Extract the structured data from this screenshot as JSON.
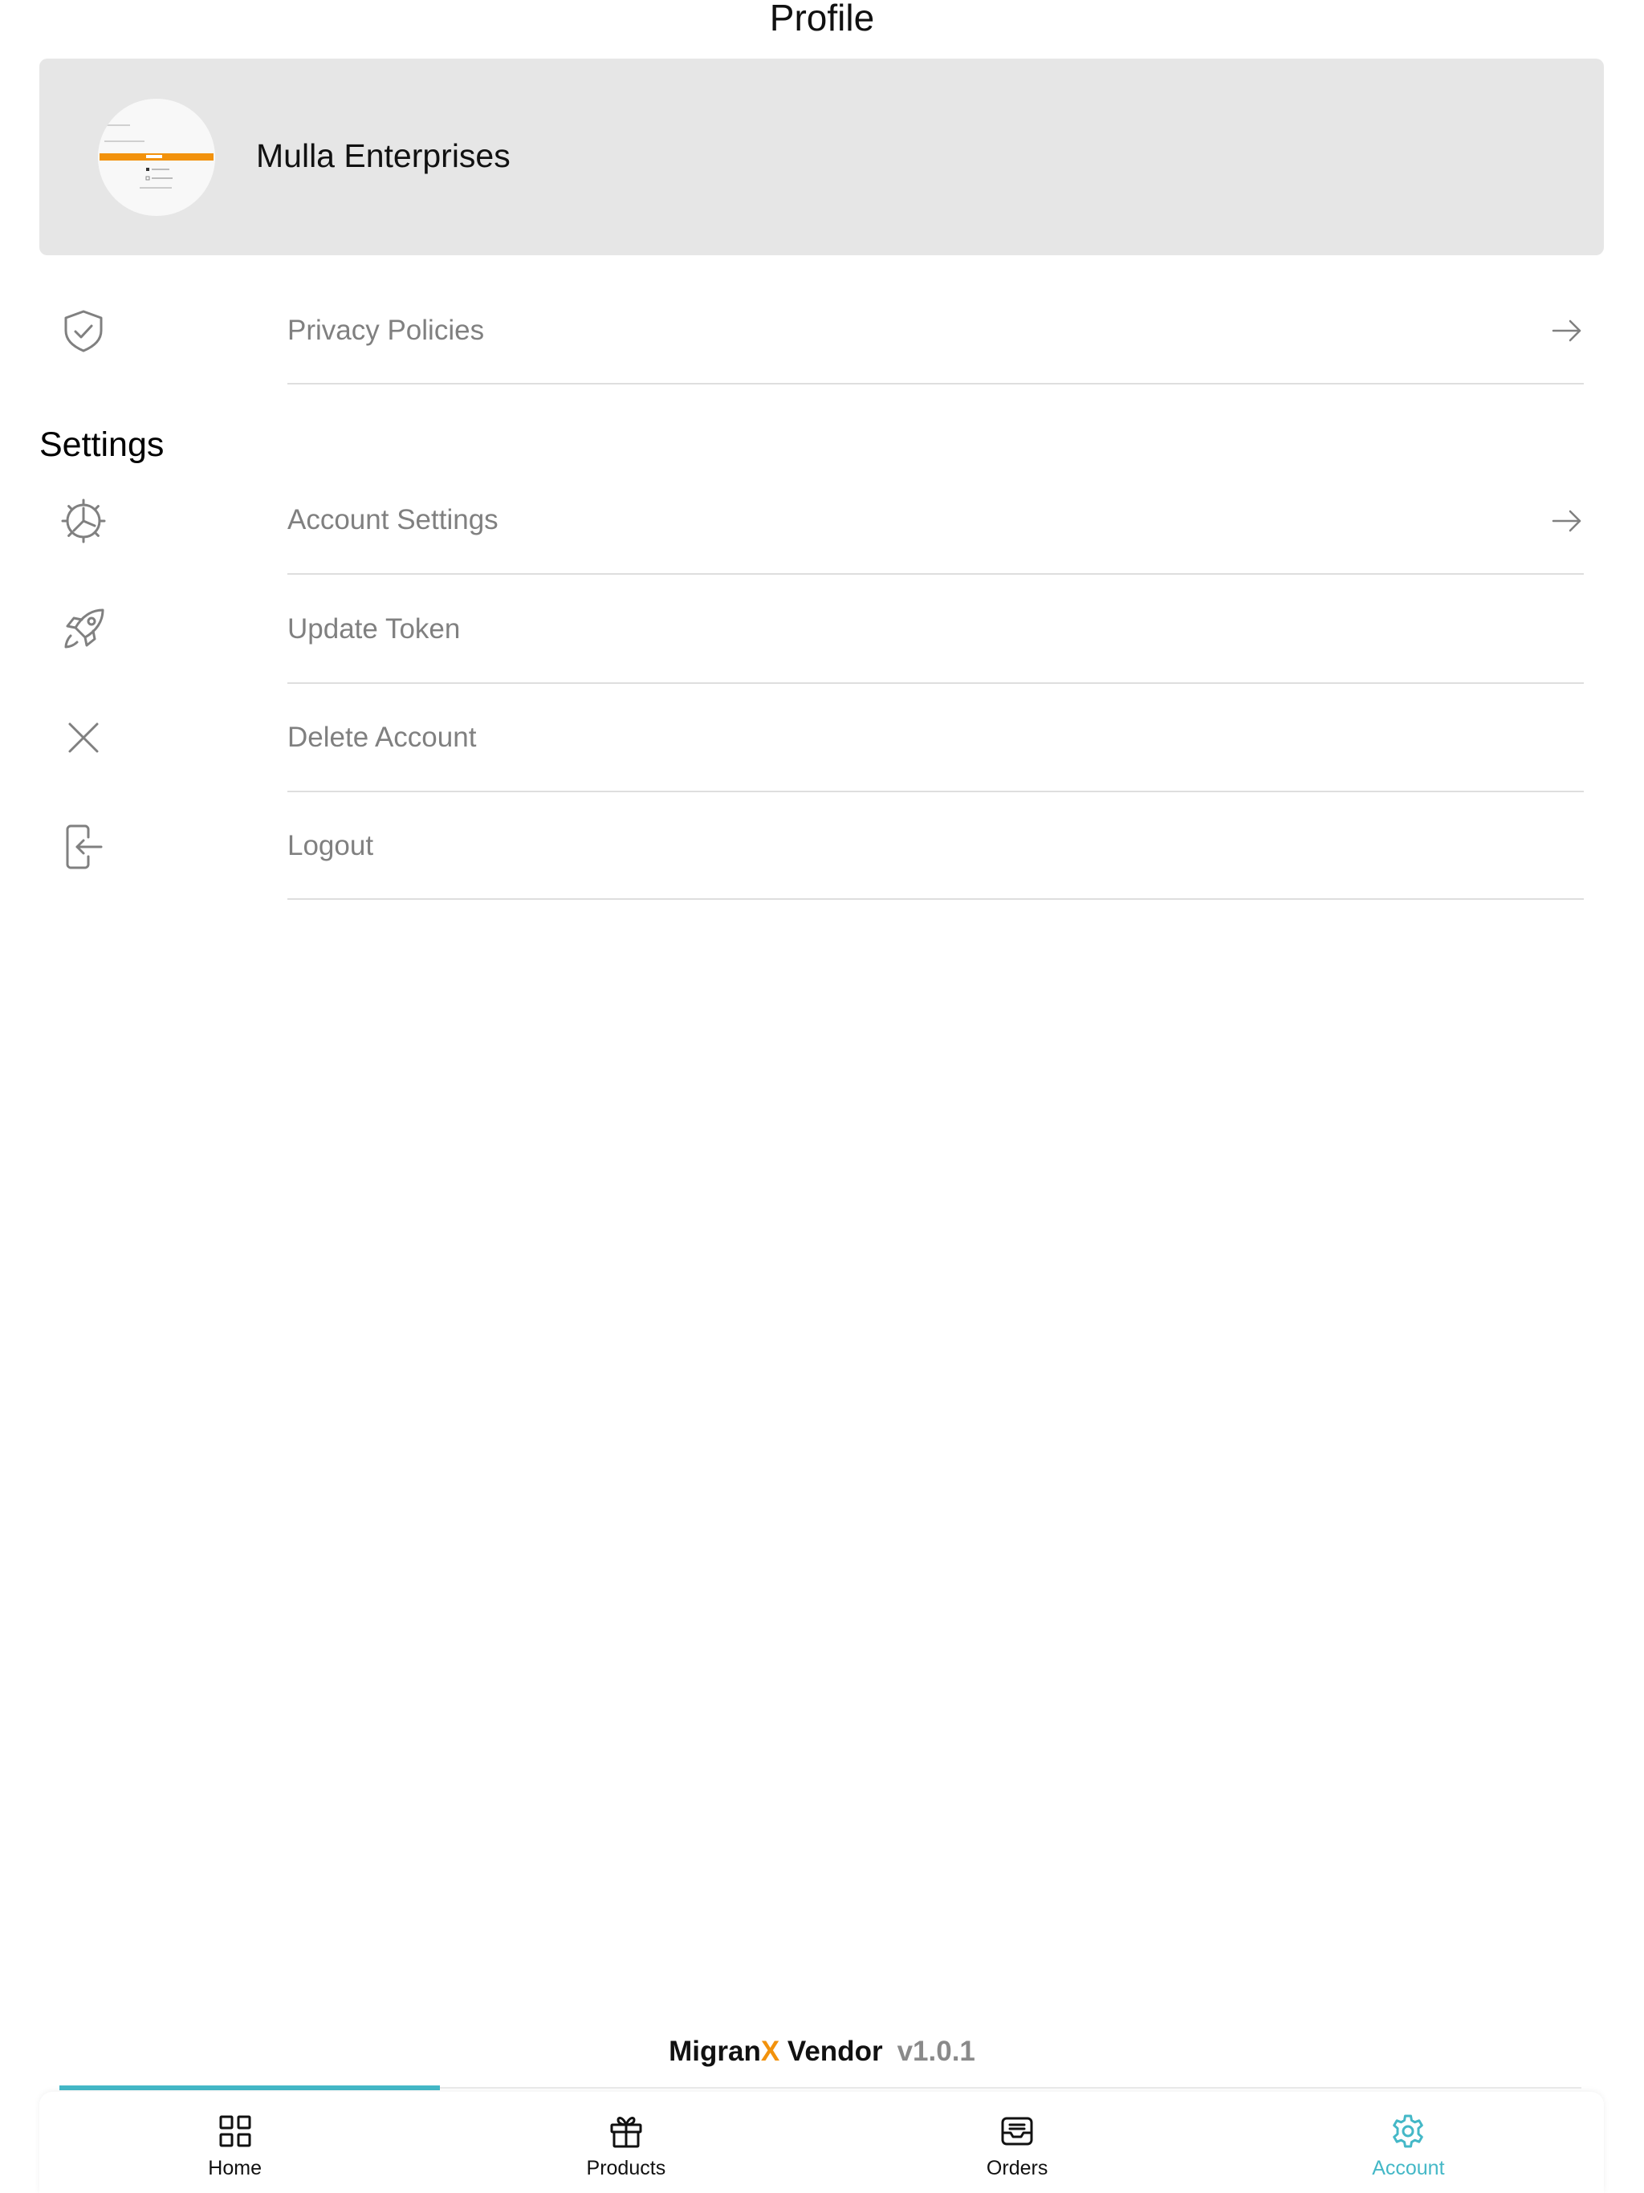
{
  "header": {
    "title": "Profile"
  },
  "profile": {
    "name": "Mulla Enterprises",
    "avatar_icon": "store-thumbnail-image"
  },
  "menu_top": [
    {
      "label": "Privacy Policies",
      "icon": "shield-check-icon",
      "arrow": true
    }
  ],
  "settings": {
    "title": "Settings",
    "items": [
      {
        "label": "Account Settings",
        "icon": "gear-icon",
        "arrow": true
      },
      {
        "label": "Update Token",
        "icon": "rocket-icon",
        "arrow": false
      },
      {
        "label": "Delete Account",
        "icon": "close-icon",
        "arrow": false
      },
      {
        "label": "Logout",
        "icon": "logout-icon",
        "arrow": false
      }
    ]
  },
  "footer": {
    "brand_prefix": "Migran",
    "brand_x": "X",
    "brand_suffix": " Vendor",
    "version": "v1.0.1",
    "brand_accent_color": "#f2920c"
  },
  "tab_bar": {
    "active_index": 3,
    "progress_fraction": 0.25,
    "active_color": "#44b8c7",
    "tabs": [
      {
        "label": "Home",
        "icon": "grid-icon"
      },
      {
        "label": "Products",
        "icon": "gift-icon"
      },
      {
        "label": "Orders",
        "icon": "inbox-icon"
      },
      {
        "label": "Account",
        "icon": "gear-icon"
      }
    ]
  }
}
